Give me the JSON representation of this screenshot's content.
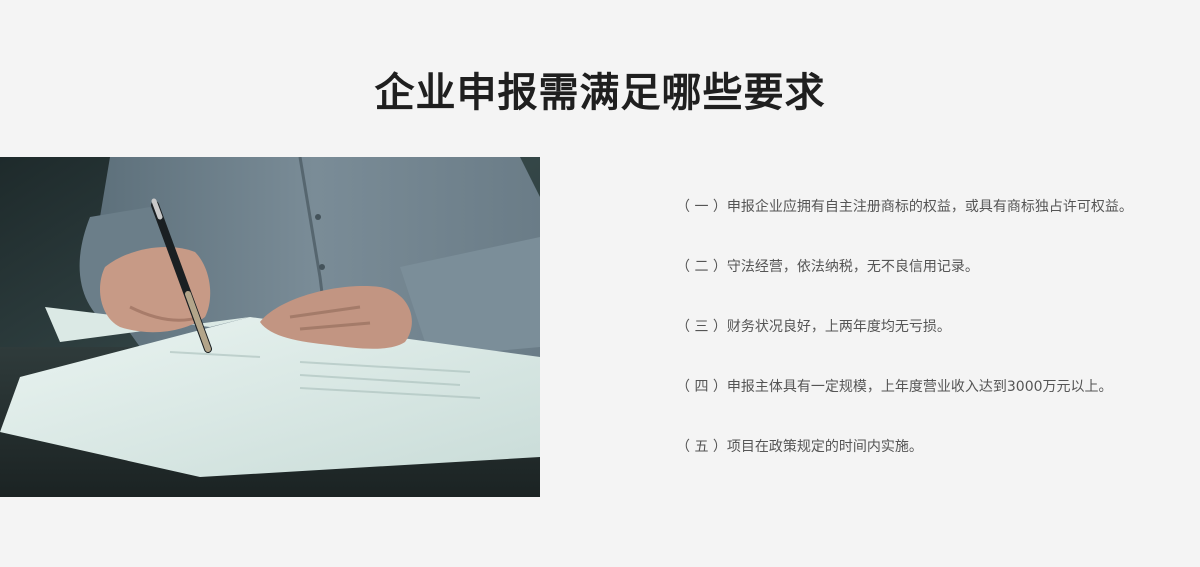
{
  "page": {
    "title": "企业申报需满足哪些要求"
  },
  "photo": {
    "icon": "document-signing-photo"
  },
  "requirements": [
    "（ 一 ）申报企业应拥有自主注册商标的权益，或具有商标独占许可权益。",
    "（ 二 ）守法经营，依法纳税，无不良信用记录。",
    "（ 三 ）财务状况良好，上两年度均无亏损。",
    "（ 四 ）申报主体具有一定规模，上年度营业收入达到3000万元以上。",
    "（ 五 ）项目在政策规定的时间内实施。"
  ],
  "colors": {
    "background": "#f4f4f4",
    "title": "#1f1f1f",
    "text": "#555555"
  }
}
